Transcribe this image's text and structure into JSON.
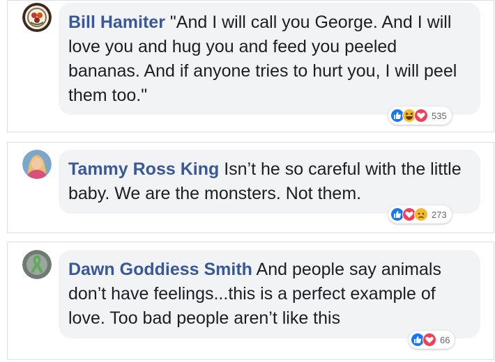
{
  "comments": [
    {
      "author": "Bill Hamiter",
      "text": "\"And I will call you George. And I will love you and hug you and feed you peeled bananas. And if anyone tries to hurt you, I will peel them too.\"",
      "reaction_count": "535",
      "reactions": [
        "like-icon",
        "haha-icon",
        "love-icon"
      ]
    },
    {
      "author": "Tammy Ross King",
      "text": "Isn’t he so careful with the little baby. We are the monsters. Not them.",
      "reaction_count": "273",
      "reactions": [
        "like-icon",
        "love-icon",
        "sad-icon"
      ]
    },
    {
      "author": "Dawn Goddiess Smith",
      "text": "And people say animals don’t have feelings...this is a perfect example of love. Too bad people aren’t like this",
      "reaction_count": "66",
      "reactions": [
        "like-icon",
        "love-icon"
      ]
    }
  ],
  "colors": {
    "name": "#385898",
    "bubble": "#f2f3f5",
    "like": "#1877f2",
    "love": "#f33e58",
    "haha_sad": "#f7b928"
  }
}
